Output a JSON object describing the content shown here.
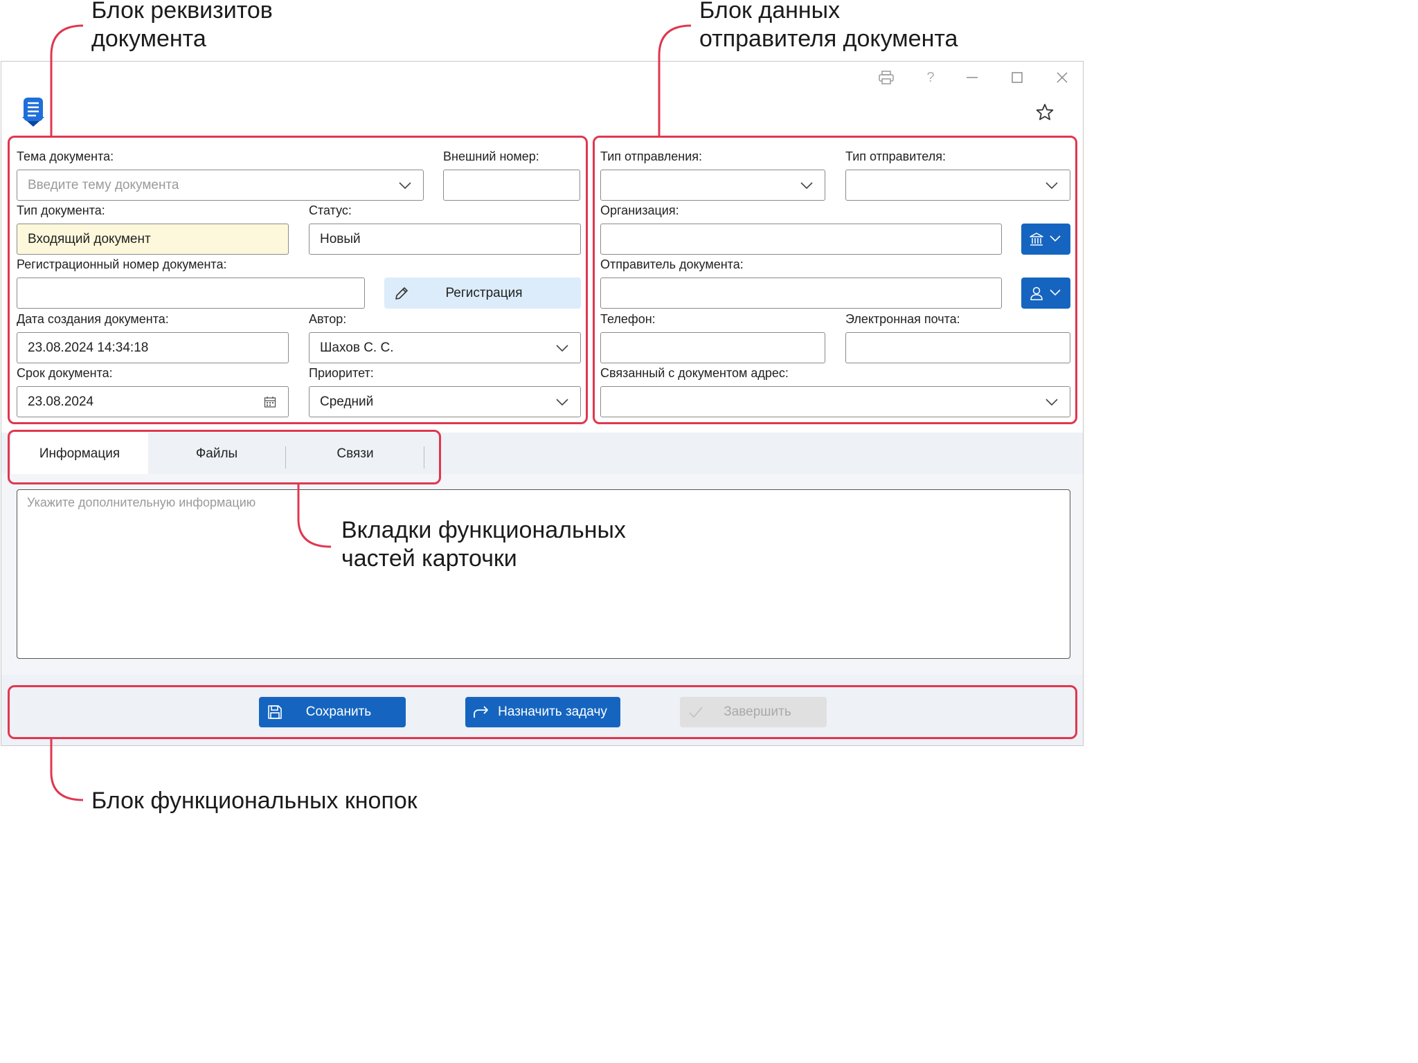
{
  "annotations": {
    "requisites_line1": "Блок реквизитов",
    "requisites_line2": "документа",
    "sender_line1": "Блок данных",
    "sender_line2": "отправителя документа",
    "tabs_line1": "Вкладки функциональных",
    "tabs_line2": "частей карточки",
    "buttons_line1": "Блок функциональных кнопок"
  },
  "colors": {
    "accent": "#1565c0",
    "callout": "#e0374f",
    "required_field_bg": "#fdf8dc",
    "registration_button_bg": "#dcecfa",
    "disabled_button_bg": "#e0e0e0"
  },
  "titlebar": {
    "icons": [
      "printer-icon",
      "help-icon",
      "minimize-icon",
      "maximize-icon",
      "close-icon"
    ],
    "help_glyph": "?"
  },
  "requisites": {
    "subject_label": "Тема документа:",
    "subject_placeholder": "Введите тему документа",
    "external_number_label": "Внешний номер:",
    "external_number_value": "",
    "doc_type_label": "Тип документа:",
    "doc_type_value": "Входящий документ",
    "status_label": "Статус:",
    "status_value": "Новый",
    "reg_number_label": "Регистрационный номер документа:",
    "reg_number_value": "",
    "registration_button": "Регистрация",
    "created_label": "Дата создания документа:",
    "created_value": "23.08.2024 14:34:18",
    "author_label": "Автор:",
    "author_value": "Шахов С. С.",
    "deadline_label": "Срок документа:",
    "deadline_value": "23.08.2024",
    "priority_label": "Приоритет:",
    "priority_value": "Средний"
  },
  "sender": {
    "dispatch_type_label": "Тип отправления:",
    "sender_type_label": "Тип отправителя:",
    "organization_label": "Организация:",
    "doc_sender_label": "Отправитель документа:",
    "phone_label": "Телефон:",
    "email_label": "Электронная почта:",
    "linked_address_label": "Связанный с документом адрес:"
  },
  "tabs": [
    {
      "label": "Информация",
      "active": true
    },
    {
      "label": "Файлы",
      "active": false
    },
    {
      "label": "Связи",
      "active": false
    }
  ],
  "info": {
    "placeholder": "Укажите дополнительную информацию"
  },
  "footer": {
    "save_label": "Сохранить",
    "assign_label": "Назначить задачу",
    "complete_label": "Завершить",
    "complete_enabled": false
  }
}
